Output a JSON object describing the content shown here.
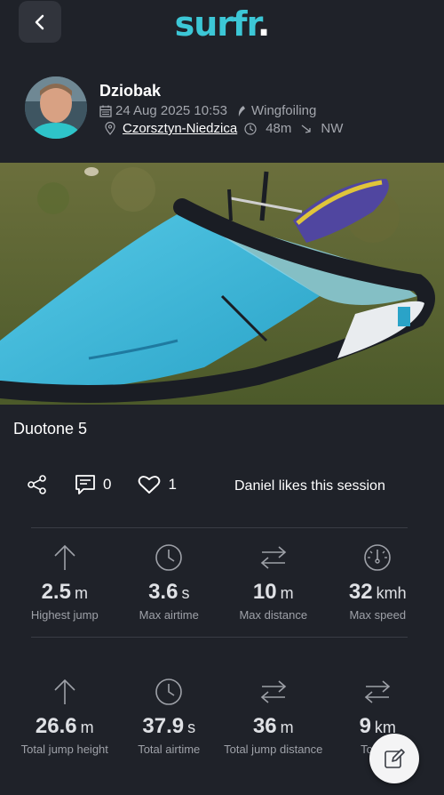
{
  "header": {
    "logo_text": "surfr",
    "logo_dot": ".",
    "back_icon": "chevron-left-icon"
  },
  "profile": {
    "username": "Dziobak",
    "datetime": "24 Aug 2025 10:53",
    "sport": "Wingfoiling",
    "location": "Czorsztyn-Niedzica",
    "duration": "48m",
    "wind_direction": "NW"
  },
  "session": {
    "title": "Duotone 5"
  },
  "actions": {
    "comments_count": "0",
    "likes_count": "1",
    "likes_text": "Daniel likes this session"
  },
  "stats_top": [
    {
      "icon": "arrow-up-icon",
      "value": "2.5",
      "unit": "m",
      "label": "Highest jump"
    },
    {
      "icon": "clock-icon",
      "value": "3.6",
      "unit": "s",
      "label": "Max airtime"
    },
    {
      "icon": "arrows-left-right-icon",
      "value": "10",
      "unit": "m",
      "label": "Max distance"
    },
    {
      "icon": "speedometer-icon",
      "value": "32",
      "unit": "kmh",
      "label": "Max speed"
    }
  ],
  "stats_bottom": [
    {
      "icon": "arrow-up-icon",
      "value": "26.6",
      "unit": "m",
      "label": "Total jump height"
    },
    {
      "icon": "clock-icon",
      "value": "37.9",
      "unit": "s",
      "label": "Total airtime"
    },
    {
      "icon": "arrows-left-right-icon",
      "value": "36",
      "unit": "m",
      "label": "Total jump distance"
    },
    {
      "icon": "arrows-left-right-icon",
      "value": "9",
      "unit": "km",
      "label": "Total d"
    }
  ],
  "colors": {
    "background": "#1f2229",
    "accent": "#3cc7d6"
  }
}
